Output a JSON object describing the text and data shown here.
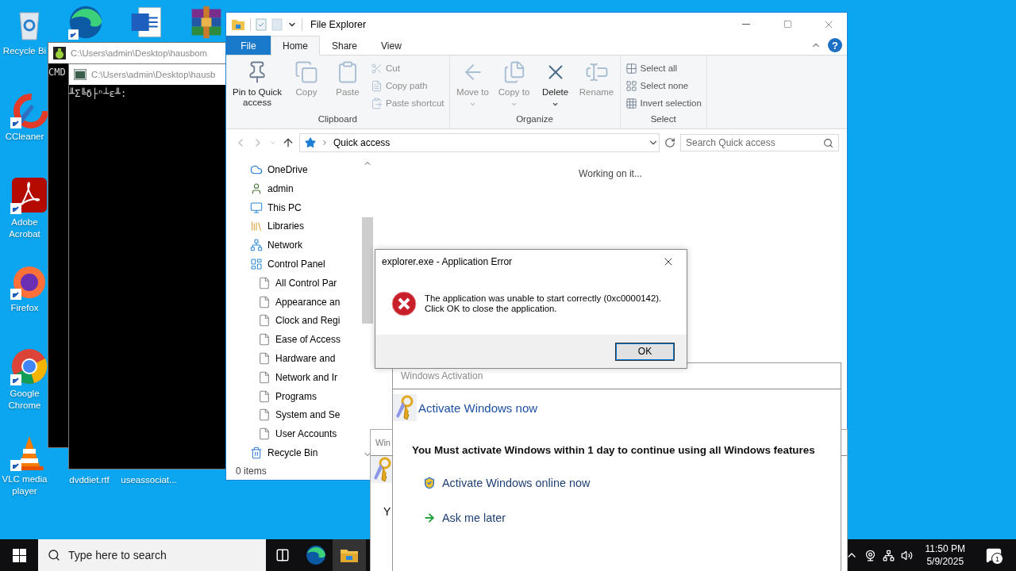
{
  "desktop": {
    "left_column": [
      {
        "kind": "recycle-bin",
        "label": "Recycle Bi",
        "shortcut": false
      },
      {
        "kind": "ccleaner",
        "label": "CCleaner",
        "shortcut": true
      },
      {
        "kind": "acrobat",
        "label": "Adobe Acrobat",
        "shortcut": true
      },
      {
        "kind": "firefox",
        "label": "Firefox",
        "shortcut": true
      },
      {
        "kind": "chrome",
        "label": "Google Chrome",
        "shortcut": true
      },
      {
        "kind": "vlc",
        "label": "VLC media player",
        "shortcut": true
      }
    ],
    "top_row": [
      {
        "kind": "edge",
        "shortcut": true
      },
      {
        "kind": "word",
        "shortcut": false
      },
      {
        "kind": "winrar",
        "shortcut": false
      }
    ],
    "bottom_row": [
      {
        "label": "dvddiet.rtf"
      },
      {
        "label": "useassociat..."
      }
    ]
  },
  "consoles": [
    {
      "kind": "bag",
      "title": "C:\\Users\\admin\\Desktop\\hausbom",
      "text": "CMD"
    },
    {
      "kind": "console",
      "title": "C:\\Users\\admin\\Desktop\\hausb",
      "text": "╨Σ╚δ├ⁿ┴ε╨:"
    }
  ],
  "explorer": {
    "title": "File Explorer",
    "help": "?",
    "tabs": [
      {
        "label": "File",
        "kind": "file",
        "selected": false
      },
      {
        "label": "Home",
        "kind": "tab",
        "selected": true
      },
      {
        "label": "Share",
        "kind": "tab",
        "selected": false
      },
      {
        "label": "View",
        "kind": "tab",
        "selected": false
      }
    ],
    "groups": [
      {
        "label": "Clipboard",
        "large": [
          {
            "label": "Pin to Quick access",
            "kind": "pin",
            "disabled": false,
            "dropdown": false
          },
          {
            "label": "Copy",
            "kind": "copy",
            "disabled": true,
            "dropdown": false
          },
          {
            "label": "Paste",
            "kind": "paste",
            "disabled": true,
            "dropdown": false
          }
        ],
        "small": [
          {
            "label": "Cut",
            "kind": "cut",
            "disabled": true
          },
          {
            "label": "Copy path",
            "kind": "copy-path",
            "disabled": true
          },
          {
            "label": "Paste shortcut",
            "kind": "paste-shortcut",
            "disabled": true
          }
        ]
      },
      {
        "label": "Organize",
        "large": [
          {
            "label": "Move to",
            "kind": "move",
            "disabled": true,
            "dropdown": true
          },
          {
            "label": "Copy to",
            "kind": "copy-to",
            "disabled": true,
            "dropdown": true
          },
          {
            "label": "Delete",
            "kind": "delete",
            "disabled": false,
            "dropdown": true
          },
          {
            "label": "Rename",
            "kind": "rename",
            "disabled": true,
            "dropdown": false
          }
        ]
      },
      {
        "label": "Select",
        "small": [
          {
            "label": "Select all",
            "kind": "select-all",
            "disabled": false
          },
          {
            "label": "Select none",
            "kind": "select-none",
            "disabled": false
          },
          {
            "label": "Invert selection",
            "kind": "invert",
            "disabled": false
          }
        ]
      }
    ],
    "address": "Quick access",
    "search": {
      "placeholder": "Search Quick access"
    },
    "nav": [
      {
        "label": "OneDrive",
        "kind": "onedrive"
      },
      {
        "label": "admin",
        "kind": "user"
      },
      {
        "label": "This PC",
        "kind": "pc"
      },
      {
        "label": "Libraries",
        "kind": "libraries"
      },
      {
        "label": "Network",
        "kind": "network"
      },
      {
        "label": "Control Panel",
        "kind": "control",
        "children": [
          {
            "label": "All Control Par",
            "kind": "page"
          },
          {
            "label": "Appearance an",
            "kind": "page"
          },
          {
            "label": "Clock and Regi",
            "kind": "page"
          },
          {
            "label": "Ease of Access",
            "kind": "page"
          },
          {
            "label": "Hardware and",
            "kind": "page"
          },
          {
            "label": "Network and Ir",
            "kind": "page"
          },
          {
            "label": "Programs",
            "kind": "page"
          },
          {
            "label": "System and Se",
            "kind": "page"
          },
          {
            "label": "User Accounts",
            "kind": "page"
          }
        ]
      },
      {
        "label": "Recycle Bin",
        "kind": "recycle"
      }
    ],
    "content": "Working on it...",
    "status": "0 items"
  },
  "error_dialog": {
    "title": "explorer.exe - Application Error",
    "message": "The application was unable to start correctly (0xc0000142).\nClick OK to close the application.",
    "button": "OK"
  },
  "activation_back": {
    "title": "Win",
    "text": "Y"
  },
  "activation": {
    "title": "Windows Activation",
    "heading": "Activate Windows now",
    "message": "You Must activate Windows within 1 day to continue using all Windows features",
    "options": [
      {
        "kind": "shield",
        "label": "Activate Windows online now"
      },
      {
        "kind": "arrow",
        "label": "Ask me later"
      }
    ]
  },
  "taskbar": {
    "search": {
      "placeholder": "Type here to search"
    },
    "apps": [
      {
        "kind": "task-view"
      },
      {
        "kind": "edge"
      },
      {
        "kind": "folder"
      }
    ],
    "time": "11:50 PM",
    "date": "5/9/2025",
    "notifications": "1"
  }
}
